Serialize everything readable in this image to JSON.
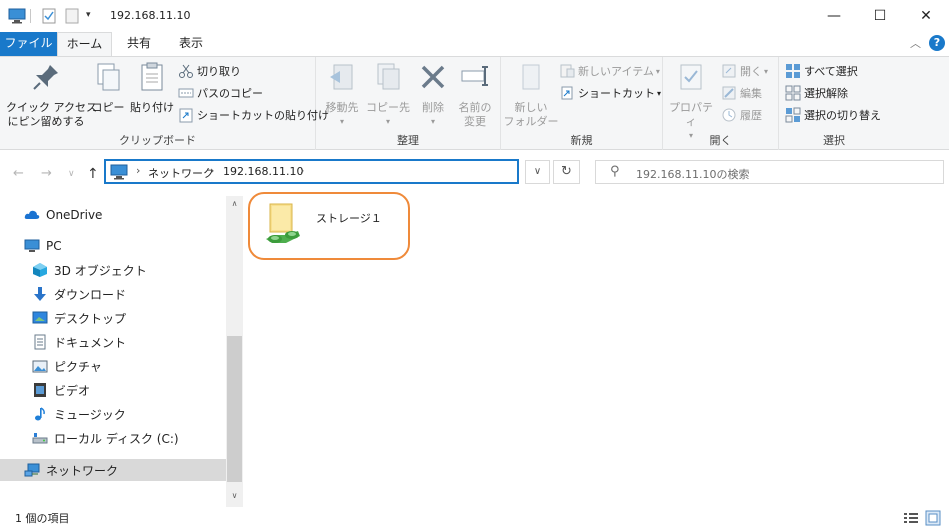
{
  "window": {
    "title": "192.168.11.10",
    "minimize": "—",
    "maximize": "☐",
    "close": "✕"
  },
  "ribbon_tabs": [
    {
      "label": "ファイル"
    },
    {
      "label": "ホーム"
    },
    {
      "label": "共有"
    },
    {
      "label": "表示"
    }
  ],
  "ribbon": {
    "clipboard": {
      "label": "クリップボード",
      "pin": "クイック アクセス\nにピン留めする",
      "copy": "コピー",
      "paste": "貼り付け",
      "cut": "切り取り",
      "copy_path": "パスのコピー",
      "paste_shortcut": "ショートカットの貼り付け"
    },
    "organize": {
      "label": "整理",
      "move_to": "移動先",
      "copy_to": "コピー先",
      "delete": "削除",
      "rename": "名前の\n変更"
    },
    "new": {
      "label": "新規",
      "new_folder": "新しい\nフォルダー",
      "new_item": "新しいアイテム",
      "shortcut": "ショートカット"
    },
    "open": {
      "label": "開く",
      "properties": "プロパティ",
      "open": "開く",
      "edit": "編集",
      "history": "履歴"
    },
    "select": {
      "label": "選択",
      "select_all": "すべて選択",
      "select_none": "選択解除",
      "invert": "選択の切り替え"
    }
  },
  "address": {
    "crumbs": [
      "ネットワーク",
      "192.168.11.10"
    ],
    "search_placeholder": "192.168.11.10の検索"
  },
  "sidebar": {
    "items": [
      {
        "label": "OneDrive",
        "icon": "cloud-icon"
      },
      {
        "label": "PC",
        "icon": "pc-icon"
      },
      {
        "label": "3D オブジェクト",
        "icon": "3d-objects-icon"
      },
      {
        "label": "ダウンロード",
        "icon": "download-icon"
      },
      {
        "label": "デスクトップ",
        "icon": "desktop-icon"
      },
      {
        "label": "ドキュメント",
        "icon": "documents-icon"
      },
      {
        "label": "ピクチャ",
        "icon": "pictures-icon"
      },
      {
        "label": "ビデオ",
        "icon": "video-icon"
      },
      {
        "label": "ミュージック",
        "icon": "music-icon"
      },
      {
        "label": "ローカル ディスク (C:)",
        "icon": "drive-icon"
      },
      {
        "label": "ネットワーク",
        "icon": "network-icon"
      }
    ]
  },
  "content": {
    "items": [
      {
        "label": "ストレージ１",
        "icon": "shared-folder-icon"
      }
    ]
  },
  "status": {
    "item_count": "1 個の項目"
  },
  "colors": {
    "accent": "#1979ca",
    "highlight_ring": "#ef8a3a",
    "selected_bg": "#d9d9d9"
  }
}
